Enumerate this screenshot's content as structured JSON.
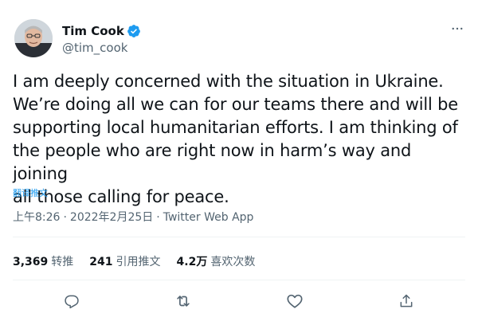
{
  "author": {
    "display_name": "Tim Cook",
    "handle": "@tim_cook",
    "avatar_icon": "avatar-photo",
    "verified_icon": "verified-badge-icon"
  },
  "tweet": {
    "text": "I am deeply concerned with the situation in Ukraine.\nWe’re doing all we can for our teams there and will be\nsupporting local humanitarian efforts. I am thinking of\nthe people who are right now in harm’s way and joining\nall those calling for peace.",
    "translate_label": "翻译推文"
  },
  "meta": {
    "time": "上午8:26",
    "separator": "·",
    "date": "2022年2月25日",
    "source": "Twitter Web App"
  },
  "stats": {
    "retweets_count": "3,369",
    "retweets_label": "转推",
    "quotes_count": "241",
    "quotes_label": "引用推文",
    "likes_count": "4.2万",
    "likes_label": "喜欢次数"
  },
  "actions": {
    "reply_icon": "reply-icon",
    "retweet_icon": "retweet-icon",
    "like_icon": "heart-icon",
    "share_icon": "share-icon"
  },
  "colors": {
    "text": "#0f1419",
    "secondary": "#536471",
    "accent": "#1d9bf0",
    "divider": "#eff3f4"
  }
}
